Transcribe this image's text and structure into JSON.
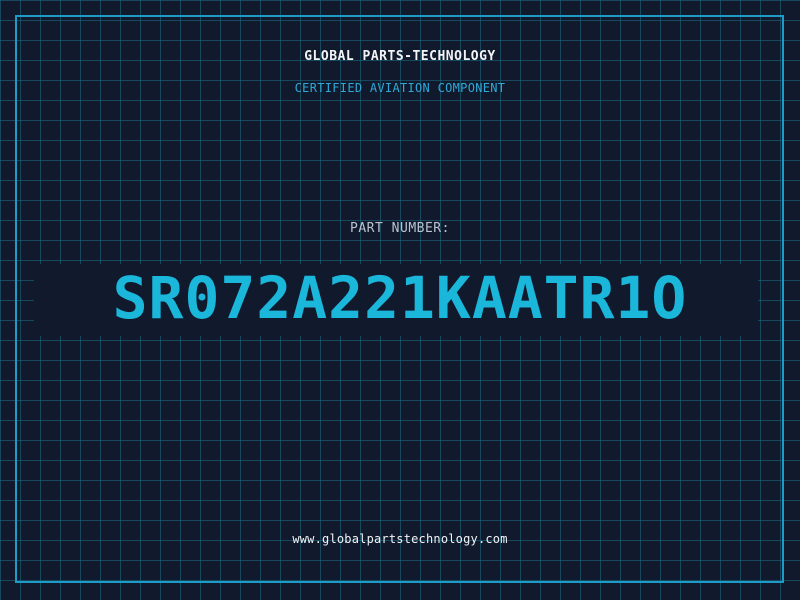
{
  "header": {
    "company_name": "GLOBAL PARTS-TECHNOLOGY",
    "tagline": "CERTIFIED AVIATION COMPONENT"
  },
  "part": {
    "label": "PART NUMBER:",
    "number": "SR072A221KAATR1O"
  },
  "footer": {
    "website": "www.globalpartstechnology.com"
  },
  "colors": {
    "background": "#111a2d",
    "grid": "#1e6e87",
    "accent": "#1ab7db",
    "border": "#1f9bc7",
    "text": "#f2f4f7"
  }
}
